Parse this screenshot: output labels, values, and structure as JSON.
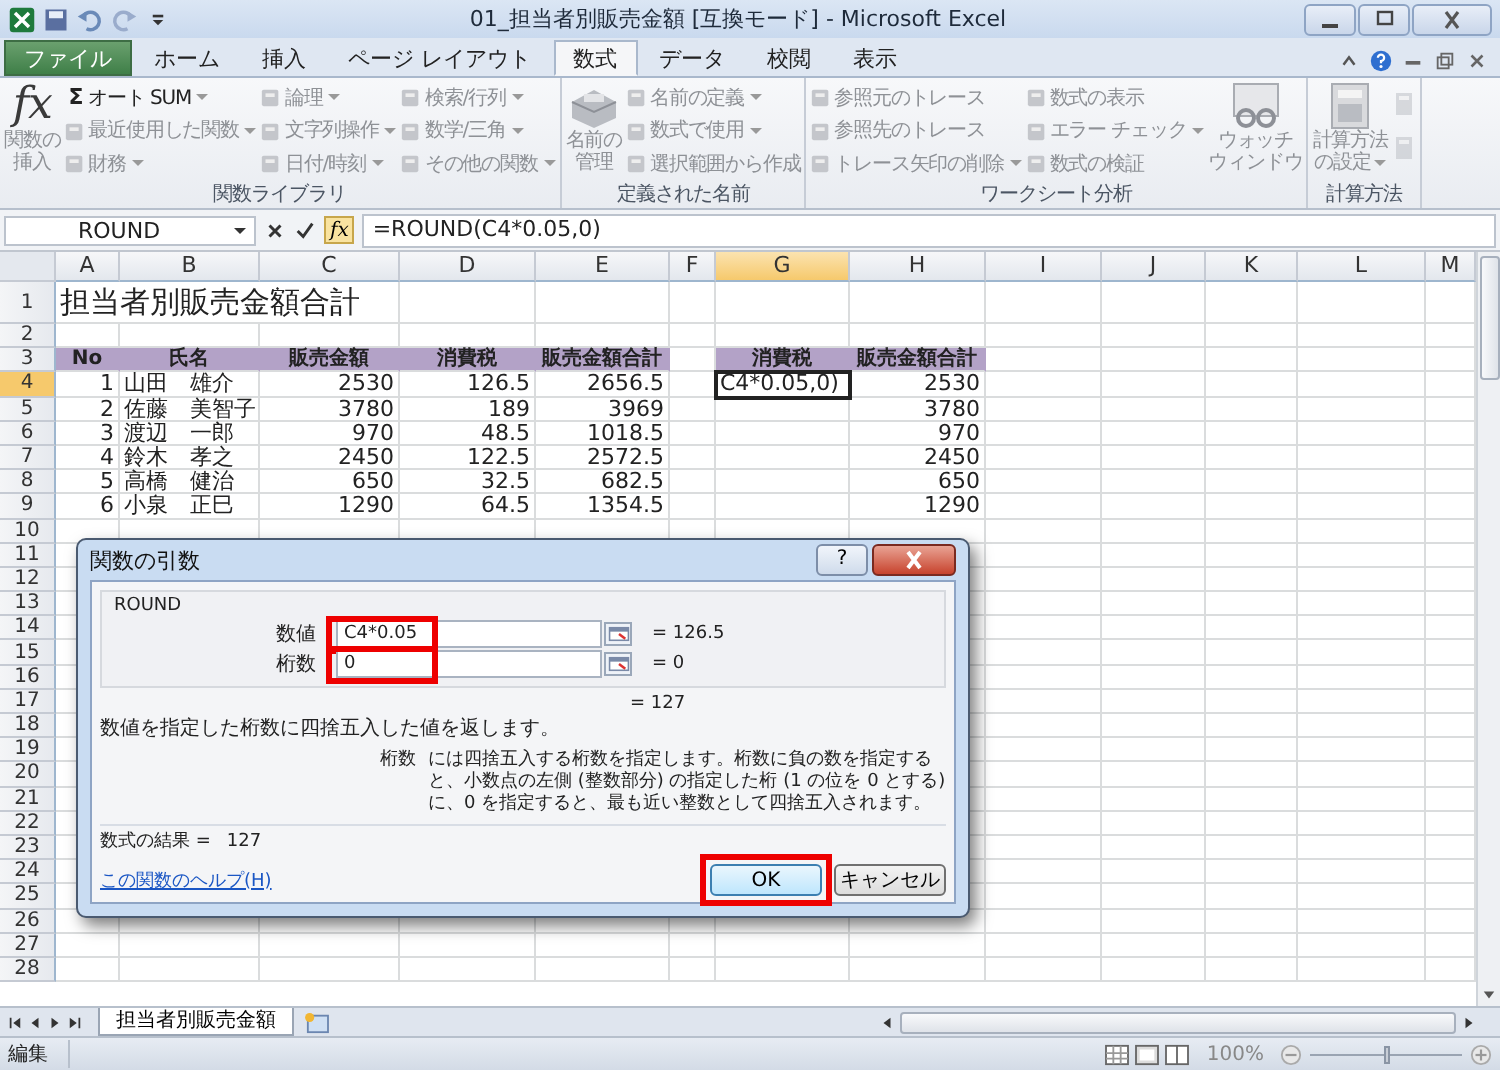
{
  "window": {
    "title": "01_担当者別販売金額 [互換モード] - Microsoft Excel"
  },
  "ribbon": {
    "tabs": [
      {
        "label": "ファイル",
        "kind": "file",
        "selected": false
      },
      {
        "label": "ホーム",
        "kind": "tab",
        "selected": false
      },
      {
        "label": "挿入",
        "kind": "tab",
        "selected": false
      },
      {
        "label": "ページ レイアウト",
        "kind": "tab",
        "selected": false
      },
      {
        "label": "数式",
        "kind": "tab",
        "selected": true
      },
      {
        "label": "データ",
        "kind": "tab",
        "selected": false
      },
      {
        "label": "校閲",
        "kind": "tab",
        "selected": false
      },
      {
        "label": "表示",
        "kind": "tab",
        "selected": false
      }
    ],
    "groups": [
      {
        "title": "関数ライブラリ",
        "columns": [
          {
            "kind": "large",
            "icon_text": "fx",
            "lines": [
              "関数の",
              "挿入"
            ],
            "disabled": true,
            "dropdown": false
          },
          {
            "kind": "small",
            "items": [
              {
                "label": "オート SUM",
                "symbol": "Σ",
                "disabled": false,
                "dropdown": true
              },
              {
                "label": "最近使用した関数",
                "disabled": true,
                "dropdown": true
              },
              {
                "label": "財務",
                "disabled": true,
                "dropdown": true
              }
            ]
          },
          {
            "kind": "small",
            "items": [
              {
                "label": "論理",
                "disabled": true,
                "dropdown": true
              },
              {
                "label": "文字列操作",
                "disabled": true,
                "dropdown": true
              },
              {
                "label": "日付/時刻",
                "disabled": true,
                "dropdown": true
              }
            ]
          },
          {
            "kind": "small",
            "items": [
              {
                "label": "検索/行列",
                "disabled": true,
                "dropdown": true
              },
              {
                "label": "数学/三角",
                "disabled": true,
                "dropdown": true
              },
              {
                "label": "その他の関数",
                "disabled": true,
                "dropdown": true
              }
            ]
          }
        ]
      },
      {
        "title": "定義された名前",
        "columns": [
          {
            "kind": "large",
            "lines": [
              "名前の",
              "管理"
            ],
            "disabled": true,
            "dropdown": false
          },
          {
            "kind": "small",
            "items": [
              {
                "label": "名前の定義",
                "disabled": true,
                "dropdown": true
              },
              {
                "label": "数式で使用",
                "disabled": true,
                "dropdown": true
              },
              {
                "label": "選択範囲から作成",
                "disabled": true,
                "dropdown": false
              }
            ]
          }
        ]
      },
      {
        "title": "ワークシート分析",
        "columns": [
          {
            "kind": "small",
            "items": [
              {
                "label": "参照元のトレース",
                "disabled": true,
                "dropdown": false
              },
              {
                "label": "参照先のトレース",
                "disabled": true,
                "dropdown": false
              },
              {
                "label": "トレース矢印の削除",
                "disabled": true,
                "dropdown": true
              }
            ]
          },
          {
            "kind": "small",
            "items": [
              {
                "label": "数式の表示",
                "disabled": true,
                "dropdown": false
              },
              {
                "label": "エラー チェック",
                "disabled": true,
                "dropdown": true
              },
              {
                "label": "数式の検証",
                "disabled": true,
                "dropdown": false
              }
            ]
          },
          {
            "kind": "large",
            "lines": [
              "ウォッチ",
              "ウィンドウ"
            ],
            "disabled": true,
            "dropdown": false
          }
        ]
      },
      {
        "title": "計算方法",
        "columns": [
          {
            "kind": "large",
            "lines": [
              "計算方法",
              "の設定"
            ],
            "disabled": true,
            "dropdown": true
          },
          {
            "kind": "icons",
            "items": [
              {
                "disabled": true
              },
              {
                "disabled": true
              }
            ]
          }
        ]
      }
    ]
  },
  "formula_bar": {
    "name_box": "ROUND",
    "insert_function": "fx",
    "formula": "=ROUND(C4*0.05,0)"
  },
  "sheet": {
    "columns": [
      {
        "letter": "A",
        "selected": false
      },
      {
        "letter": "B",
        "selected": false
      },
      {
        "letter": "C",
        "selected": false
      },
      {
        "letter": "D",
        "selected": false
      },
      {
        "letter": "E",
        "selected": false
      },
      {
        "letter": "F",
        "selected": false
      },
      {
        "letter": "G",
        "selected": true
      },
      {
        "letter": "H",
        "selected": false
      },
      {
        "letter": "I",
        "selected": false
      },
      {
        "letter": "J",
        "selected": false
      },
      {
        "letter": "K",
        "selected": false
      },
      {
        "letter": "L",
        "selected": false
      },
      {
        "letter": "M",
        "selected": false
      }
    ],
    "rows": [
      {
        "number": "1",
        "selected": false,
        "kind": "title",
        "cells": {
          "a": "担当者別販売金額合計"
        }
      },
      {
        "number": "2",
        "selected": false,
        "kind": "data"
      },
      {
        "number": "3",
        "selected": false,
        "kind": "header",
        "cells": {
          "a": "No",
          "b": "氏名",
          "c": "販売金額",
          "d": "消費税",
          "e": "販売金額合計",
          "g": "消費税",
          "h": "販売金額合計"
        }
      },
      {
        "number": "4",
        "selected": true,
        "kind": "data",
        "cells": {
          "a": "1",
          "b": "山田　雄介",
          "c": "2530",
          "d": "126.5",
          "e": "2656.5",
          "g": "C4*0.05,0)",
          "h": "2530"
        }
      },
      {
        "number": "5",
        "selected": false,
        "kind": "data",
        "cells": {
          "a": "2",
          "b": "佐藤　美智子",
          "c": "3780",
          "d": "189",
          "e": "3969",
          "h": "3780"
        }
      },
      {
        "number": "6",
        "selected": false,
        "kind": "data",
        "cells": {
          "a": "3",
          "b": "渡辺　一郎",
          "c": "970",
          "d": "48.5",
          "e": "1018.5",
          "h": "970"
        }
      },
      {
        "number": "7",
        "selected": false,
        "kind": "data",
        "cells": {
          "a": "4",
          "b": "鈴木　孝之",
          "c": "2450",
          "d": "122.5",
          "e": "2572.5",
          "h": "2450"
        }
      },
      {
        "number": "8",
        "selected": false,
        "kind": "data",
        "cells": {
          "a": "5",
          "b": "高橋　健治",
          "c": "650",
          "d": "32.5",
          "e": "682.5",
          "h": "650"
        }
      },
      {
        "number": "9",
        "selected": false,
        "kind": "data",
        "cells": {
          "a": "6",
          "b": "小泉　正巳",
          "c": "1290",
          "d": "64.5",
          "e": "1354.5",
          "h": "1290"
        }
      },
      {
        "number": "10",
        "selected": false,
        "kind": "data"
      },
      {
        "number": "11",
        "selected": false,
        "kind": "data"
      },
      {
        "number": "12",
        "selected": false,
        "kind": "data"
      },
      {
        "number": "13",
        "selected": false,
        "kind": "data"
      },
      {
        "number": "14",
        "selected": false,
        "kind": "data"
      },
      {
        "number": "15",
        "selected": false,
        "kind": "data"
      },
      {
        "number": "16",
        "selected": false,
        "kind": "data"
      },
      {
        "number": "17",
        "selected": false,
        "kind": "data"
      },
      {
        "number": "18",
        "selected": false,
        "kind": "data"
      },
      {
        "number": "19",
        "selected": false,
        "kind": "data"
      },
      {
        "number": "20",
        "selected": false,
        "kind": "data"
      },
      {
        "number": "21",
        "selected": false,
        "kind": "data"
      },
      {
        "number": "22",
        "selected": false,
        "kind": "data"
      },
      {
        "number": "23",
        "selected": false,
        "kind": "data"
      },
      {
        "number": "24",
        "selected": false,
        "kind": "data"
      },
      {
        "number": "25",
        "selected": false,
        "kind": "data"
      },
      {
        "number": "26",
        "selected": false,
        "kind": "data"
      },
      {
        "number": "27",
        "selected": false,
        "kind": "data"
      },
      {
        "number": "28",
        "selected": false,
        "kind": "data"
      }
    ]
  },
  "dialog": {
    "title": "関数の引数",
    "help_button": "?",
    "function_name": "ROUND",
    "arguments": [
      {
        "label": "数値",
        "value": "C4*0.05",
        "result": "= 126.5",
        "highlighted": true
      },
      {
        "label": "桁数",
        "value": "0",
        "result": "= 0",
        "highlighted": true
      }
    ],
    "result": "= 127",
    "description": "数値を指定した桁数に四捨五入した値を返します。",
    "argument_help": {
      "label": "桁数",
      "text": "には四捨五入する桁数を指定します。桁数に負の数を指定すると、小数点の左側 (整数部分) の指定した桁 (1 の位を 0 とする) に、0 を指定すると、最も近い整数として四捨五入されます。"
    },
    "formula_result_label": "数式の結果 =",
    "formula_result": "127",
    "help_link": "この関数のヘルプ(H)",
    "buttons": [
      {
        "label": "OK",
        "kind": "primary",
        "highlighted": true
      },
      {
        "label": "キャンセル",
        "kind": "cancel",
        "highlighted": false
      }
    ]
  },
  "sheet_tabs": [
    {
      "label": "担当者別販売金額",
      "selected": true
    }
  ],
  "status_bar": {
    "mode": "編集",
    "zoom": "100%",
    "zoom_slider": {
      "level": 0.5
    }
  }
}
